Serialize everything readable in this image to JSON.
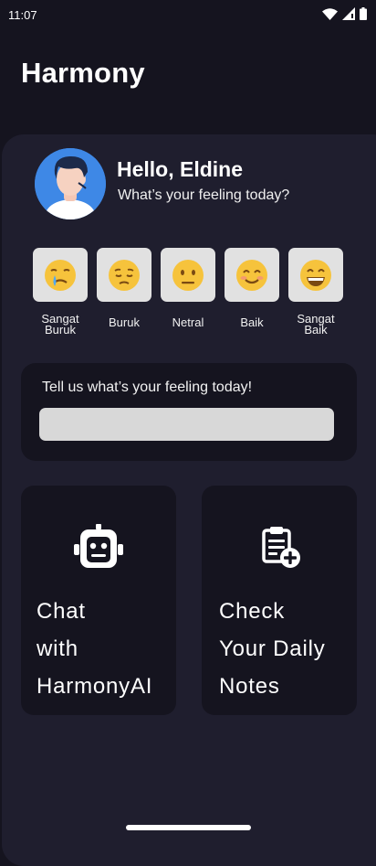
{
  "status_bar": {
    "time": "11:07",
    "icons": [
      "wifi-icon",
      "cell-signal-icon",
      "battery-icon"
    ]
  },
  "app": {
    "title": "Harmony"
  },
  "profile": {
    "greeting": "Hello, Eldine",
    "subtitle": "What’s your feeling today?",
    "avatar": "avatar-icon"
  },
  "moods": [
    {
      "emoji": "😢",
      "label": "Sangat\nBuruk"
    },
    {
      "emoji": "😔",
      "label": "Buruk"
    },
    {
      "emoji": "😐",
      "label": "Netral"
    },
    {
      "emoji": "😊",
      "label": "Baik"
    },
    {
      "emoji": "😄",
      "label": "Sangat\nBaik"
    }
  ],
  "feeling_card": {
    "prompt": "Tell us what’s your feeling today!",
    "value": "",
    "placeholder": ""
  },
  "cards": [
    {
      "label": "Chat\nwith\nHarmonyAI",
      "icon": "robot-icon"
    },
    {
      "label": "Check\nYour Daily\nNotes",
      "icon": "clipboard-add-icon"
    }
  ],
  "colors": {
    "background": "#15141f",
    "panel": "#1f1e2e",
    "mood_button": "#e1e1e1",
    "input": "#d8d8d8",
    "avatar_bg": "#3e88e6"
  }
}
